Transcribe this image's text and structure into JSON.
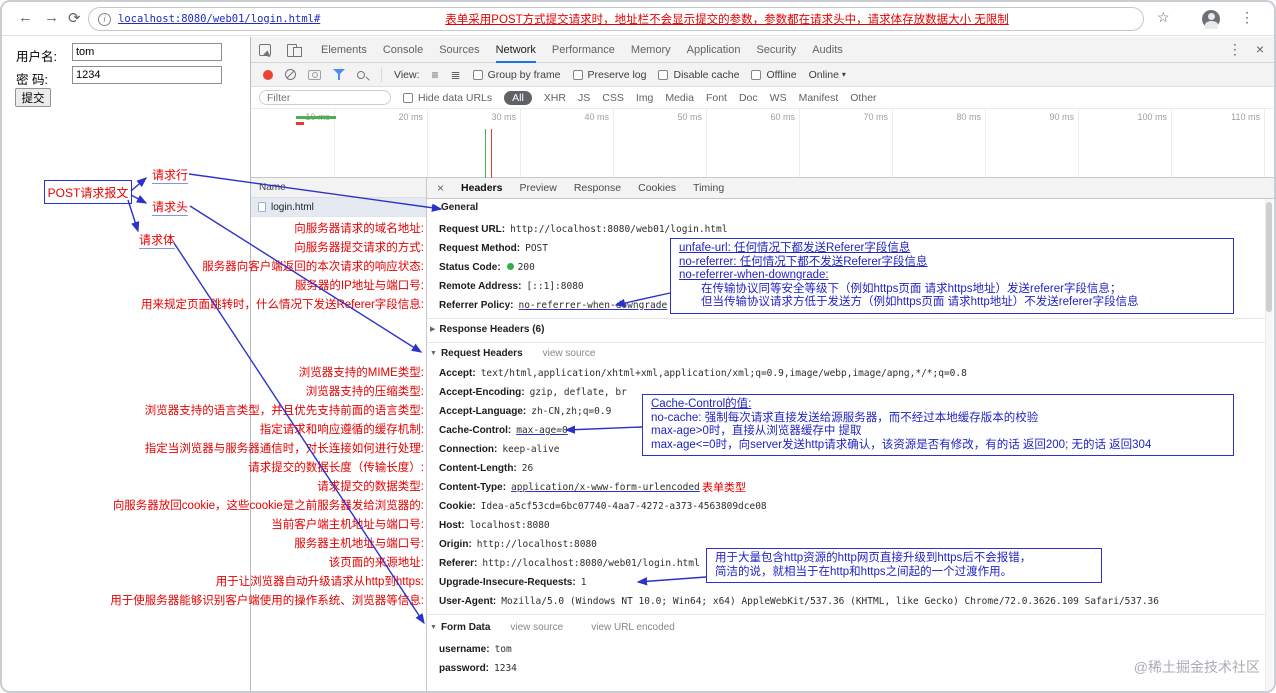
{
  "icons": {
    "back": "←",
    "forward": "→",
    "reload": "⟳",
    "info": "i",
    "star": "☆",
    "menu": "⋮",
    "devtools_menu": "⋮",
    "devtools_close": "×",
    "detail_close": "×",
    "caret_down": "▾",
    "tri_open": "▼",
    "tri_closed": "▶",
    "view_list": "≡",
    "view_large": "≣"
  },
  "browser": {
    "url": "localhost:8080/web01/login.html#",
    "url_annotation": "表单采用POST方式提交请求时，地址栏不会显示提交的参数，参数都在请求头中，请求体存放数据大小 无限制"
  },
  "page": {
    "username_label": "用户名:",
    "username_value": "tom",
    "password_label": "密 码:",
    "password_value": "1234",
    "submit_label": "提交"
  },
  "diagram": {
    "box": "POST请求报文",
    "line1": "请求行",
    "line2": "请求头",
    "line3": "请求体"
  },
  "annotations": {
    "rows": [
      "向服务器请求的域名地址:",
      "向服务器提交请求的方式:",
      "服务器向客户端返回的本次请求的响应状态:",
      "服务器的IP地址与端口号:",
      "用来规定页面跳转时，什么情况下发送Referer字段信息:",
      "浏览器支持的MIME类型:",
      "浏览器支持的压缩类型:",
      "浏览器支持的语言类型，并且优先支持前面的语言类型:",
      "指定请求和响应遵循的缓存机制:",
      "指定当浏览器与服务器通信时，对长连接如何进行处理:",
      "请求提交的数据长度（传输长度）:",
      "请求提交的数据类型:",
      "向服务器放回cookie，这些cookie是之前服务器发给浏览器的:",
      "当前客户端主机地址与端口号:",
      "服务器主机地址与端口号:",
      "该页面的来源地址:",
      "用于让浏览器自动升级请求从http到https:",
      "用于使服务器能够识别客户端使用的操作系统、浏览器等信息:"
    ],
    "form_type": "表单类型"
  },
  "callouts": {
    "referrer": {
      "l1": "unfafe-url: 任何情况下都发送Referer字段信息",
      "l2": "no-referrer: 任何情况下都不发送Referer字段信息",
      "l3": "no-referrer-when-downgrade:",
      "l4": "在传输协议同等安全等级下（例如https页面 请求https地址）发送referer字段信息；",
      "l5": "但当传输协议请求方低于发送方（例如https页面 请求http地址）不发送referer字段信息"
    },
    "cache": {
      "l1": "Cache-Control的值:",
      "l2": "no-cache: 强制每次请求直接发送给源服务器，而不经过本地缓存版本的校验",
      "l3": "max-age>0时，直接从浏览器缓存中 提取",
      "l4": "max-age<=0时，向server发送http请求确认，该资源是否有修改，有的话 返回200; 无的话 返回304"
    },
    "upgrade": {
      "l1": "用于大量包含http资源的http网页直接升级到https后不会报错，",
      "l2": "简洁的说，就相当于在http和https之间起的一个过渡作用。"
    }
  },
  "devtools": {
    "tabs": [
      "Elements",
      "Console",
      "Sources",
      "Network",
      "Performance",
      "Memory",
      "Application",
      "Security",
      "Audits"
    ],
    "toolbar": {
      "view": "View:",
      "group_by_frame": "Group by frame",
      "preserve_log": "Preserve log",
      "disable_cache": "Disable cache",
      "offline": "Offline",
      "online": "Online"
    },
    "filter": {
      "placeholder": "Filter",
      "hide_data_urls": "Hide data URLs",
      "types": [
        "All",
        "XHR",
        "JS",
        "CSS",
        "Img",
        "Media",
        "Font",
        "Doc",
        "WS",
        "Manifest",
        "Other"
      ]
    },
    "timeline": {
      "ticks": [
        "10 ms",
        "20 ms",
        "30 ms",
        "40 ms",
        "50 ms",
        "60 ms",
        "70 ms",
        "80 ms",
        "90 ms",
        "100 ms",
        "110 ms"
      ]
    },
    "request_list": {
      "name_header": "Name",
      "row": "login.html"
    },
    "detail_tabs": [
      "Headers",
      "Preview",
      "Response",
      "Cookies",
      "Timing"
    ],
    "general": {
      "title": "General",
      "items": [
        {
          "name": "Request URL:",
          "value": "http://localhost:8080/web01/login.html"
        },
        {
          "name": "Request Method:",
          "value": "POST"
        },
        {
          "name": "Status Code:",
          "value": "200"
        },
        {
          "name": "Remote Address:",
          "value": "[::1]:8080"
        },
        {
          "name": "Referrer Policy:",
          "value": "no-referrer-when-downgrade"
        }
      ]
    },
    "response_headers": {
      "title": "Response Headers (6)"
    },
    "request_headers": {
      "title": "Request Headers",
      "view_source": "view source",
      "items": [
        {
          "name": "Accept:",
          "value": "text/html,application/xhtml+xml,application/xml;q=0.9,image/webp,image/apng,*/*;q=0.8"
        },
        {
          "name": "Accept-Encoding:",
          "value": "gzip, deflate, br"
        },
        {
          "name": "Accept-Language:",
          "value": "zh-CN,zh;q=0.9"
        },
        {
          "name": "Cache-Control:",
          "value": "max-age=0"
        },
        {
          "name": "Connection:",
          "value": "keep-alive"
        },
        {
          "name": "Content-Length:",
          "value": "26"
        },
        {
          "name": "Content-Type:",
          "value": "application/x-www-form-urlencoded"
        },
        {
          "name": "Cookie:",
          "value": "Idea-a5cf53cd=6bc07740-4aa7-4272-a373-4563809dce08"
        },
        {
          "name": "Host:",
          "value": "localhost:8080"
        },
        {
          "name": "Origin:",
          "value": "http://localhost:8080"
        },
        {
          "name": "Referer:",
          "value": "http://localhost:8080/web01/login.html"
        },
        {
          "name": "Upgrade-Insecure-Requests:",
          "value": "1"
        },
        {
          "name": "User-Agent:",
          "value": "Mozilla/5.0 (Windows NT 10.0; Win64; x64) AppleWebKit/537.36 (KHTML, like Gecko) Chrome/72.0.3626.109 Safari/537.36"
        }
      ]
    },
    "form_data": {
      "title": "Form Data",
      "view_source": "view source",
      "view_url_encoded": "view URL encoded",
      "items": [
        {
          "name": "username:",
          "value": "tom"
        },
        {
          "name": "password:",
          "value": "1234"
        }
      ]
    }
  },
  "watermark": "@稀土掘金技术社区"
}
